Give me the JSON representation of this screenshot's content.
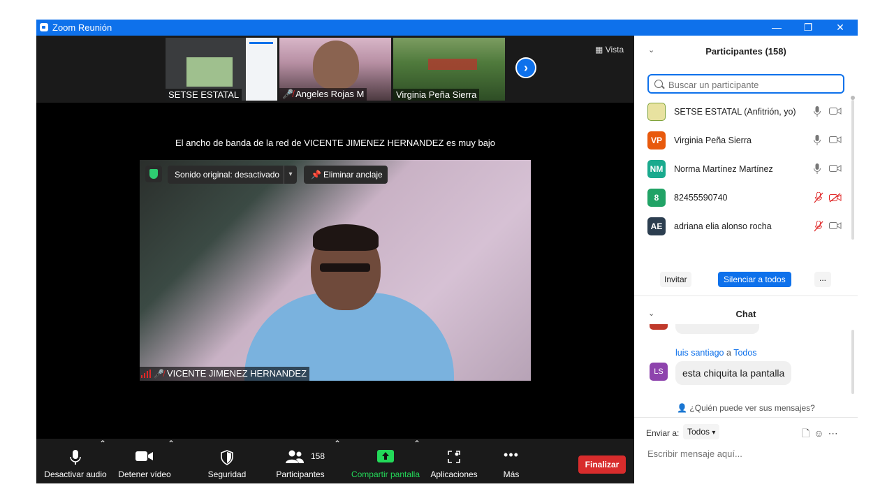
{
  "window": {
    "title": "Zoom Reunión",
    "minimize": "—",
    "restore": "❐",
    "close": "✕"
  },
  "thumbnails": [
    {
      "name": "SETSE ESTATAL",
      "muted": false
    },
    {
      "name": "Angeles Rojas M",
      "muted": true
    },
    {
      "name": "Virginia Peña Sierra",
      "muted": false
    }
  ],
  "view_button": "Vista",
  "bandwidth_message": "El ancho de banda de la red de VICENTE JIMENEZ HERNANDEZ es muy bajo",
  "main_video": {
    "sound_label": "Sonido original: desactivado",
    "unpin_label": "Eliminar anclaje",
    "speaker_name": "VICENTE JIMENEZ HERNANDEZ"
  },
  "toolbar": {
    "mute": "Desactivar audio",
    "video": "Detener vídeo",
    "security": "Seguridad",
    "participants": "Participantes",
    "participants_count": "158",
    "share": "Compartir pantalla",
    "apps": "Aplicaciones",
    "more": "Más",
    "end": "Finalizar"
  },
  "participants_panel": {
    "title": "Participantes (158)",
    "search_placeholder": "Buscar un participante",
    "items": [
      {
        "initials": "",
        "name": "SETSE ESTATAL (Anfitrión, yo)",
        "color": "#e8e2a0",
        "mic_muted": false,
        "cam_off": false
      },
      {
        "initials": "VP",
        "name": "Virginia Peña Sierra",
        "color": "#e8590c",
        "mic_muted": false,
        "cam_off": false
      },
      {
        "initials": "NM",
        "name": "Norma Martínez Martínez",
        "color": "#1aaa8e",
        "mic_muted": false,
        "cam_off": false
      },
      {
        "initials": "8",
        "name": "82455590740",
        "color": "#21a366",
        "mic_muted": true,
        "cam_off": true
      },
      {
        "initials": "AE",
        "name": "adriana elia alonso rocha",
        "color": "#2c3e50",
        "mic_muted": true,
        "cam_off": false
      }
    ],
    "invite": "Invitar",
    "mute_all": "Silenciar a todos",
    "more": "..."
  },
  "chat_panel": {
    "title": "Chat",
    "message": {
      "sender": "luis santiago",
      "connector": "a",
      "recipient": "Todos",
      "avatar": "LS",
      "text": "esta chiquita la pantalla"
    },
    "who_sees": "¿Quién puede ver sus mensajes?",
    "send_to_label": "Enviar a:",
    "send_to_value": "Todos",
    "input_placeholder": "Escribir mensaje aquí..."
  },
  "colors": {
    "accent": "#0e71eb",
    "end": "#d82c2c",
    "share": "#23d959",
    "muted": "#e02828"
  }
}
